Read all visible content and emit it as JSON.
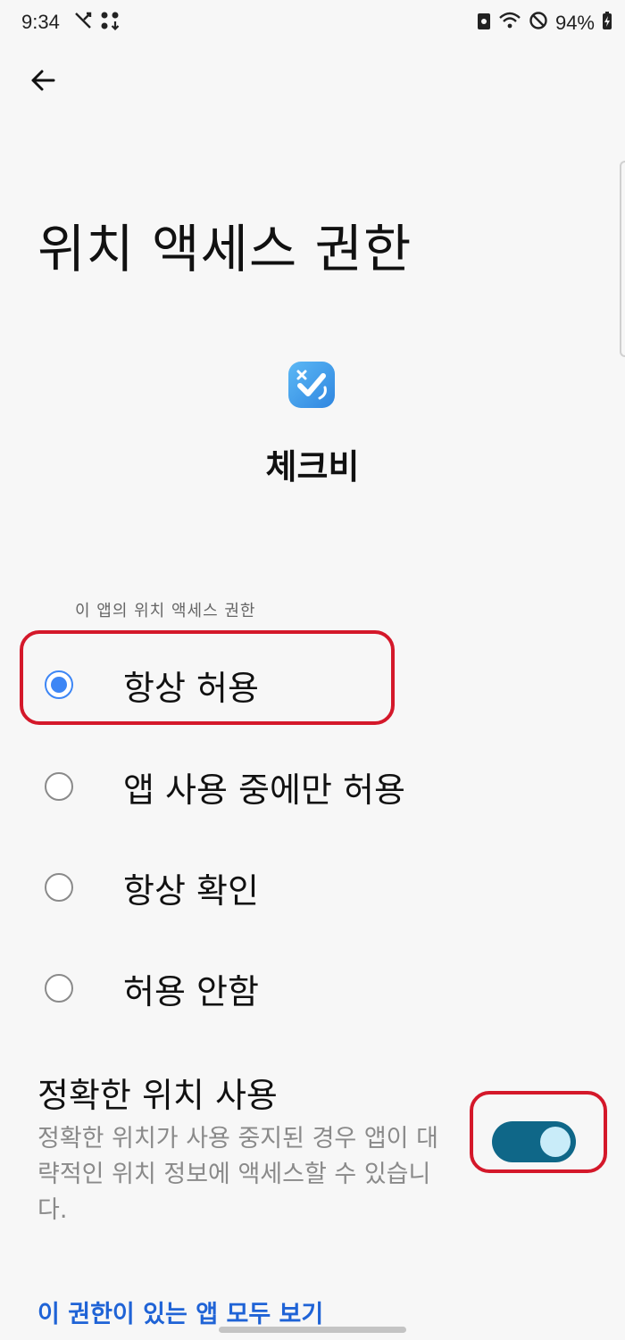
{
  "status_bar": {
    "time": "9:34",
    "battery": "94%"
  },
  "header": {
    "title": "위치 액세스 권한"
  },
  "app": {
    "name": "체크비",
    "icon_color": "#3d9df0"
  },
  "permission": {
    "section_label": "이 앱의 위치 액세스 권한",
    "options": [
      {
        "label": "항상 허용",
        "checked": true
      },
      {
        "label": "앱 사용 중에만 허용",
        "checked": false
      },
      {
        "label": "항상 확인",
        "checked": false
      },
      {
        "label": "허용 안함",
        "checked": false
      }
    ]
  },
  "precise_location": {
    "title": "정확한 위치 사용",
    "description": "정확한 위치가 사용 중지된 경우 앱이 대략적인 위치 정보에 액세스할 수 있습니다.",
    "enabled": true
  },
  "footer": {
    "see_all_link": "이 권한이 있는 앱 모두 보기"
  },
  "colors": {
    "accent": "#3d86f5",
    "toggle_on": "#0f6788",
    "highlight": "#d4182a",
    "link": "#1f63d6"
  }
}
